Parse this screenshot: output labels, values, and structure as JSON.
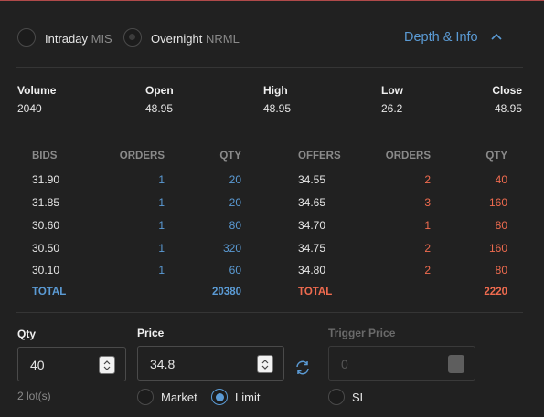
{
  "product": {
    "intraday_label": "Intraday",
    "intraday_code": "MIS",
    "overnight_label": "Overnight",
    "overnight_code": "NRML"
  },
  "depth_link": "Depth & Info",
  "stats": [
    {
      "label": "Volume",
      "value": "2040"
    },
    {
      "label": "Open",
      "value": "48.95"
    },
    {
      "label": "High",
      "value": "48.95"
    },
    {
      "label": "Low",
      "value": "26.2"
    },
    {
      "label": "Close",
      "value": "48.95"
    }
  ],
  "depth": {
    "headers": [
      "BIDS",
      "ORDERS",
      "QTY",
      "OFFERS",
      "ORDERS",
      "QTY"
    ],
    "bids": [
      {
        "price": "31.90",
        "orders": "1",
        "qty": "20"
      },
      {
        "price": "31.85",
        "orders": "1",
        "qty": "20"
      },
      {
        "price": "30.60",
        "orders": "1",
        "qty": "80"
      },
      {
        "price": "30.50",
        "orders": "1",
        "qty": "320"
      },
      {
        "price": "30.10",
        "orders": "1",
        "qty": "60"
      }
    ],
    "offers": [
      {
        "price": "34.55",
        "orders": "2",
        "qty": "40"
      },
      {
        "price": "34.65",
        "orders": "3",
        "qty": "160"
      },
      {
        "price": "34.70",
        "orders": "1",
        "qty": "80"
      },
      {
        "price": "34.75",
        "orders": "2",
        "qty": "160"
      },
      {
        "price": "34.80",
        "orders": "2",
        "qty": "80"
      }
    ],
    "total_bids_label": "TOTAL",
    "total_bids_qty": "20380",
    "total_offers_label": "TOTAL",
    "total_offers_qty": "2220"
  },
  "order": {
    "qty_label": "Qty",
    "qty_value": "40",
    "lots": "2 lot(s)",
    "price_label": "Price",
    "price_value": "34.8",
    "market_label": "Market",
    "limit_label": "Limit",
    "trigger_label": "Trigger Price",
    "trigger_value": "0",
    "sl_label": "SL"
  },
  "colors": {
    "bid": "#5b9bd5",
    "offer": "#ef6b4f",
    "link": "#5b9bd5"
  }
}
